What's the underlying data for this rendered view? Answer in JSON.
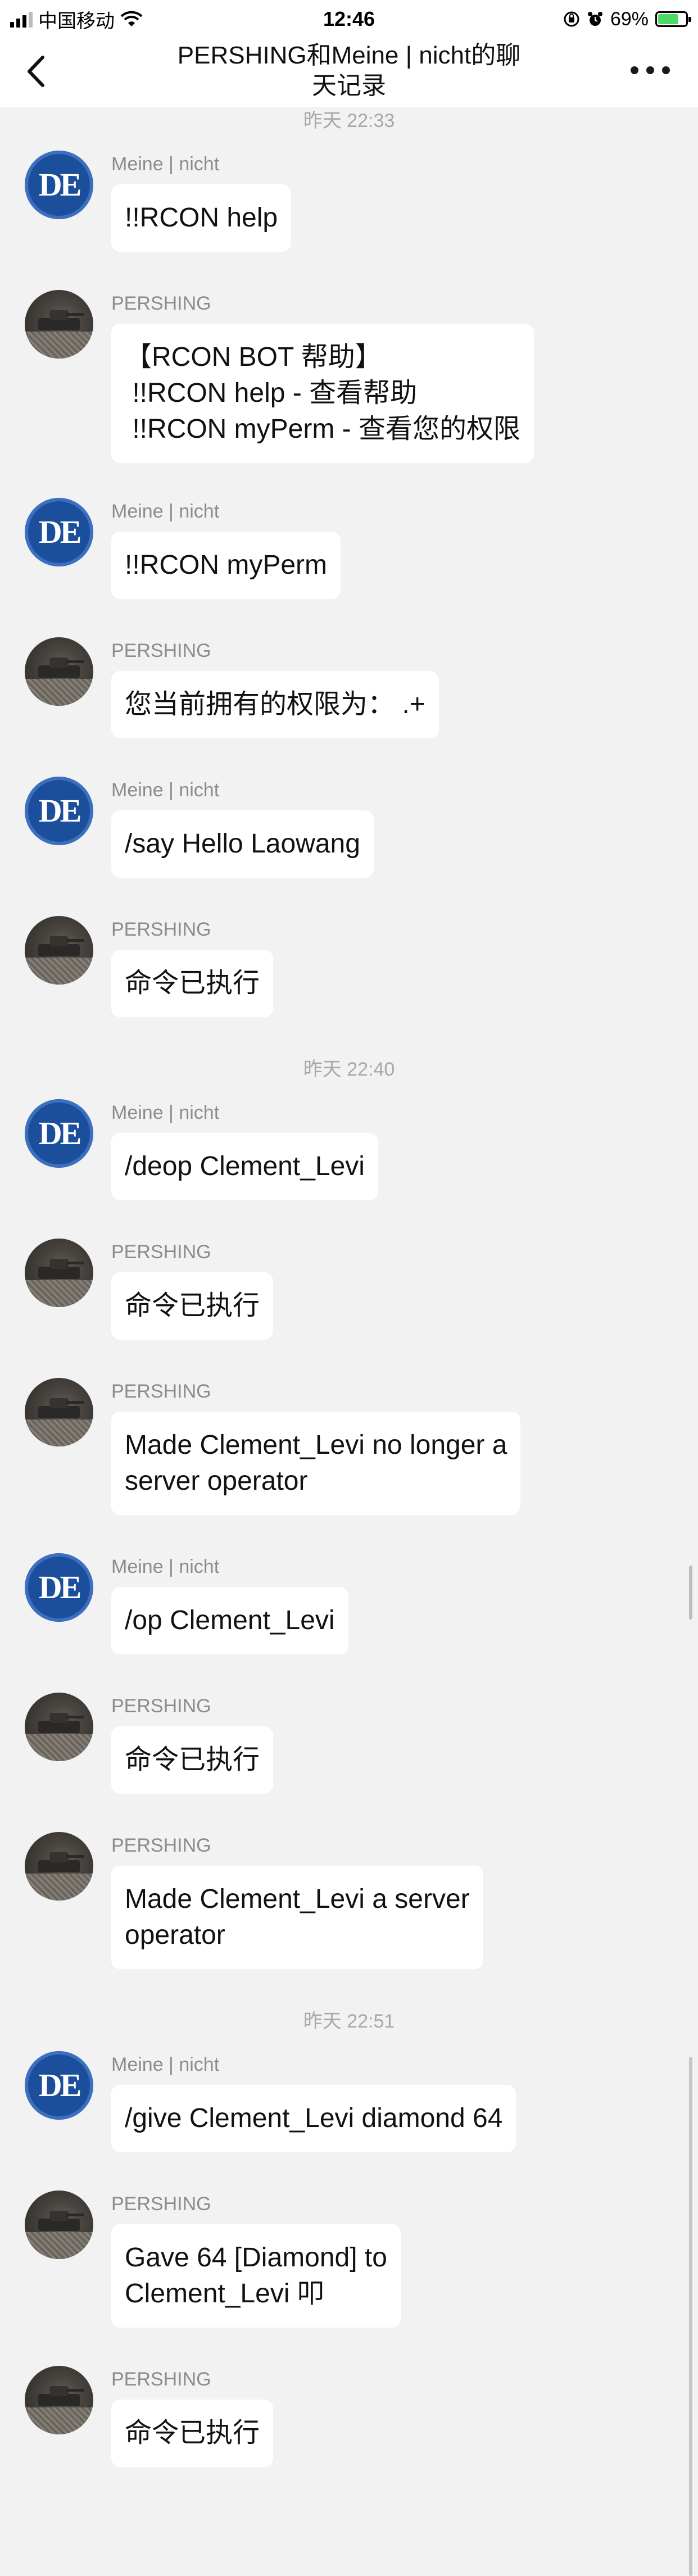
{
  "status_bar": {
    "carrier": "中国移动",
    "time": "12:46",
    "battery_percent": "69%"
  },
  "header": {
    "title_line1": "PERSHING和Meine | nicht的聊",
    "title_line2": "天记录"
  },
  "chat": {
    "dividers": [
      "昨天 22:33",
      "昨天 22:40",
      "昨天 22:51"
    ],
    "messages": [
      {
        "sender": "Meine | nicht",
        "text": "!!RCON help"
      },
      {
        "sender": "PERSHING",
        "text": "【RCON BOT 帮助】\n !!RCON help - 查看帮助\n !!RCON myPerm - 查看您的权限"
      },
      {
        "sender": "Meine | nicht",
        "text": "!!RCON myPerm"
      },
      {
        "sender": "PERSHING",
        "text": "您当前拥有的权限为： .+"
      },
      {
        "sender": "Meine | nicht",
        "text": "/say Hello Laowang"
      },
      {
        "sender": "PERSHING",
        "text": "命令已执行"
      },
      {
        "sender": "Meine | nicht",
        "text": "/deop Clement_Levi"
      },
      {
        "sender": "PERSHING",
        "text": "命令已执行"
      },
      {
        "sender": "PERSHING",
        "text": "Made Clement_Levi no longer a\nserver operator"
      },
      {
        "sender": "Meine | nicht",
        "text": "/op Clement_Levi"
      },
      {
        "sender": "PERSHING",
        "text": "命令已执行"
      },
      {
        "sender": "PERSHING",
        "text": "Made Clement_Levi a server\noperator"
      },
      {
        "sender": "Meine | nicht",
        "text": "/give Clement_Levi diamond 64"
      },
      {
        "sender": "PERSHING",
        "text": "Gave 64 [Diamond] to\nClement_Levi 叩"
      },
      {
        "sender": "PERSHING",
        "text": "命令已执行"
      }
    ]
  },
  "avatars": {
    "meine_text": "DE"
  }
}
